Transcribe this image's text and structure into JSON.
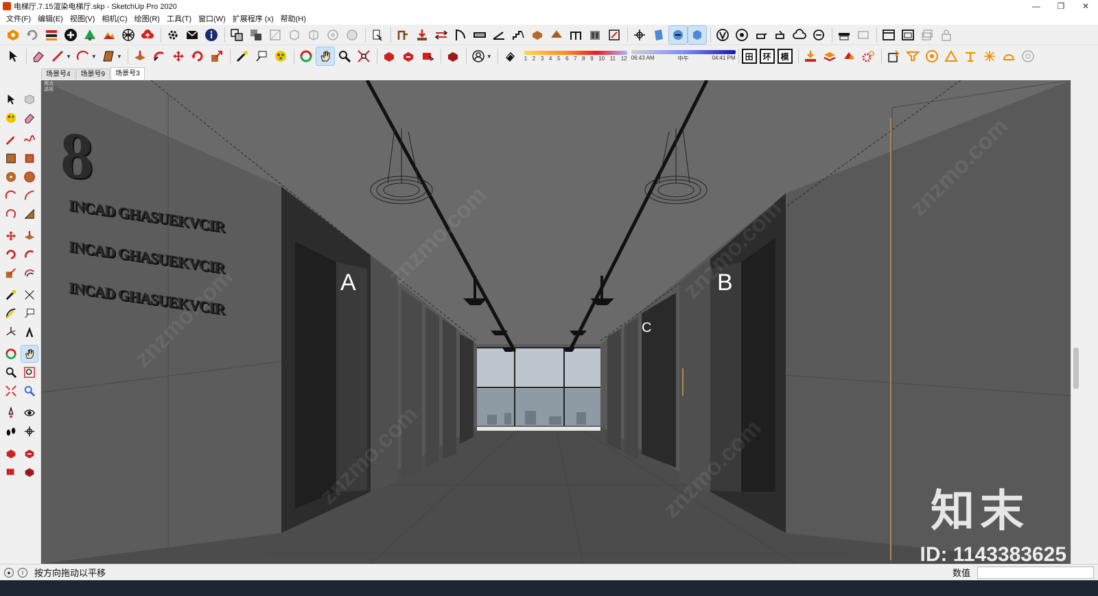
{
  "window": {
    "title": "电梯厅.7.15渲染电梯厅.skp - SketchUp Pro 2020",
    "minimize_glyph": "—",
    "restore_glyph": "❐",
    "close_glyph": "✕"
  },
  "menu": [
    "文件(F)",
    "编辑(E)",
    "视图(V)",
    "相机(C)",
    "绘图(R)",
    "工具(T)",
    "窗口(W)",
    "扩展程序 (x)",
    "帮助(H)"
  ],
  "shadow": {
    "months": [
      "1",
      "2",
      "3",
      "4",
      "5",
      "6",
      "7",
      "8",
      "9",
      "10",
      "11",
      "12"
    ],
    "time_start": "06:43 AM",
    "time_mid": "中午",
    "time_end": "04:41 PM"
  },
  "toolbar_boxes": [
    "田",
    "环",
    "模"
  ],
  "scene_tabs": [
    {
      "label": "场景号4",
      "active": false
    },
    {
      "label": "场景号9",
      "active": false
    },
    {
      "label": "场景号3",
      "active": true
    }
  ],
  "viewport": {
    "camera_label_1": "两点",
    "camera_label_2": "透视",
    "floor_number": "8",
    "wall_lines": [
      "INCAD GHASUEKVCIR",
      "INCAD GHASUEKVCIR",
      "INCAD GHASUEKVCIR"
    ],
    "elevator_a": "A",
    "elevator_b": "B",
    "elevator_c": "C",
    "brand_watermark": "知末",
    "id_watermark": "ID: 1143383625"
  },
  "status": {
    "hint": "按方向拖动以平移",
    "value_label": "数值",
    "value": ""
  },
  "colors": {
    "accent_red": "#d02020",
    "accent_orange": "#f08a00",
    "wall_gray": "#5a5a5a",
    "ceiling_gray": "#666666"
  }
}
